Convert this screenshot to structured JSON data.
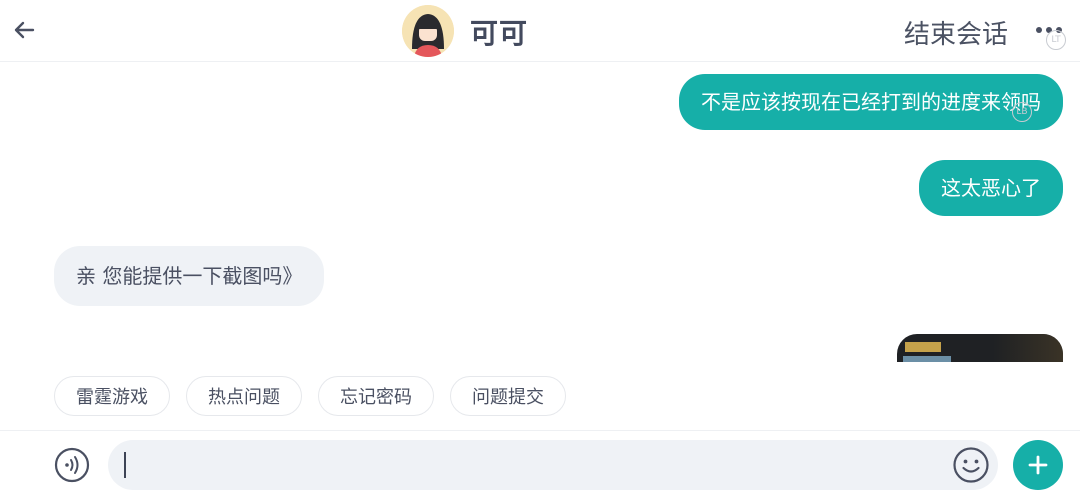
{
  "header": {
    "title": "可可",
    "end_session_label": "结束会话",
    "back_icon": "back-arrow-icon",
    "more_icon": "more-dots-icon"
  },
  "messages": [
    {
      "from": "me",
      "text": "不是应该按现在已经打到的进度来领吗"
    },
    {
      "from": "me",
      "text": "这太恶心了"
    },
    {
      "from": "them",
      "text": "亲 您能提供一下截图吗》"
    },
    {
      "from": "me",
      "type": "image"
    }
  ],
  "quick_replies": [
    "雷霆游戏",
    "热点问题",
    "忘记密码",
    "问题提交"
  ],
  "input": {
    "value": "",
    "placeholder": ""
  },
  "colors": {
    "accent": "#16afa8",
    "bubble_them": "#eff2f6",
    "text": "#3d4455"
  }
}
